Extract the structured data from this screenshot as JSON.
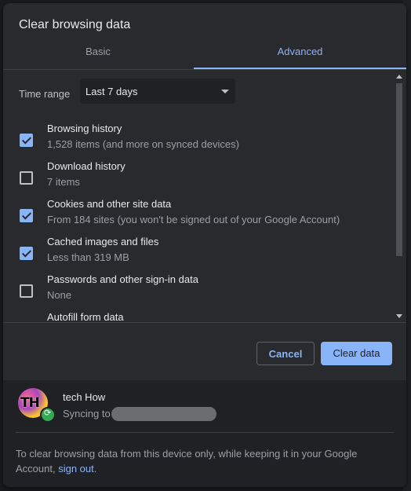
{
  "dialog": {
    "title": "Clear browsing data"
  },
  "tabs": [
    {
      "label": "Basic",
      "selected": false
    },
    {
      "label": "Advanced",
      "selected": true
    }
  ],
  "time_range": {
    "label": "Time range",
    "selected": "Last 7 days"
  },
  "items": [
    {
      "label": "Browsing history",
      "detail": "1,528 items (and more on synced devices)",
      "checked": true
    },
    {
      "label": "Download history",
      "detail": "7 items",
      "checked": false
    },
    {
      "label": "Cookies and other site data",
      "detail": "From 184 sites (you won't be signed out of your Google Account)",
      "checked": true
    },
    {
      "label": "Cached images and files",
      "detail": "Less than 319 MB",
      "checked": true
    },
    {
      "label": "Passwords and other sign-in data",
      "detail": "None",
      "checked": false
    },
    {
      "label": "Autofill form data",
      "detail": "",
      "checked": false
    }
  ],
  "buttons": {
    "cancel": "Cancel",
    "clear": "Clear data"
  },
  "account": {
    "name": "tech How",
    "avatar_letters": "TH",
    "sync_text": "Syncing to"
  },
  "footnote": {
    "text": "To clear browsing data from this device only, while keeping it in your Google Account,",
    "link": "sign out",
    "end": "."
  },
  "colors": {
    "accent": "#8ab4f8",
    "dialog_bg": "#292a2d",
    "footer_bg": "#202124"
  }
}
